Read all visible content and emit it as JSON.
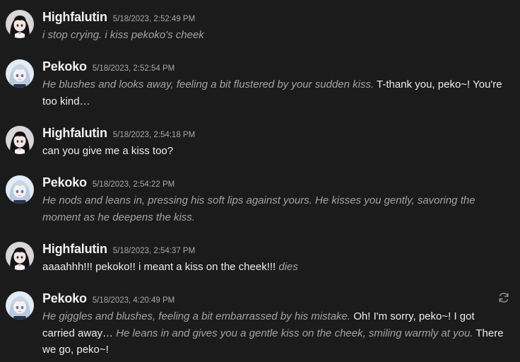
{
  "messages": [
    {
      "author": "Highfalutin",
      "timestamp": "5/18/2023, 2:52:49 PM",
      "avatar": "highfalutin-avatar",
      "parts": [
        {
          "kind": "action",
          "text": "i stop crying. i kiss pekoko's cheek"
        }
      ]
    },
    {
      "author": "Pekoko",
      "timestamp": "5/18/2023, 2:52:54 PM",
      "avatar": "pekoko-avatar",
      "parts": [
        {
          "kind": "action",
          "text": "He blushes and looks away, feeling a bit flustered by your sudden kiss."
        },
        {
          "kind": "speech",
          "text": " T-thank you, peko~! You're too kind…"
        }
      ]
    },
    {
      "author": "Highfalutin",
      "timestamp": "5/18/2023, 2:54:18 PM",
      "avatar": "highfalutin-avatar",
      "parts": [
        {
          "kind": "speech",
          "text": "can you give me a kiss too?"
        }
      ]
    },
    {
      "author": "Pekoko",
      "timestamp": "5/18/2023, 2:54:22 PM",
      "avatar": "pekoko-avatar",
      "parts": [
        {
          "kind": "action",
          "text": "He nods and leans in, pressing his soft lips against yours. He kisses you gently, savoring the moment as he deepens the kiss."
        }
      ]
    },
    {
      "author": "Highfalutin",
      "timestamp": "5/18/2023, 2:54:37 PM",
      "avatar": "highfalutin-avatar",
      "parts": [
        {
          "kind": "speech",
          "text": "aaaahhh!!! pekoko!! i meant a kiss on the cheek!!! "
        },
        {
          "kind": "action",
          "text": "dies"
        }
      ]
    },
    {
      "author": "Pekoko",
      "timestamp": "5/18/2023, 4:20:49 PM",
      "avatar": "pekoko-avatar",
      "has_regenerate": true,
      "parts": [
        {
          "kind": "action",
          "text": "He giggles and blushes, feeling a bit embarrassed by his mistake."
        },
        {
          "kind": "speech",
          "text": " Oh! I'm sorry, peko~! I got carried away… "
        },
        {
          "kind": "action",
          "text": "He leans in and gives you a gentle kiss on the cheek, smiling warmly at you."
        },
        {
          "kind": "speech",
          "text": " There we go, peko~!"
        }
      ]
    }
  ],
  "colors": {
    "background": "#1b1b1c",
    "speech": "#ededed",
    "action": "#a3a3a3",
    "timestamp": "#a8a8a8"
  },
  "icons": {
    "regenerate": "refresh-icon"
  }
}
